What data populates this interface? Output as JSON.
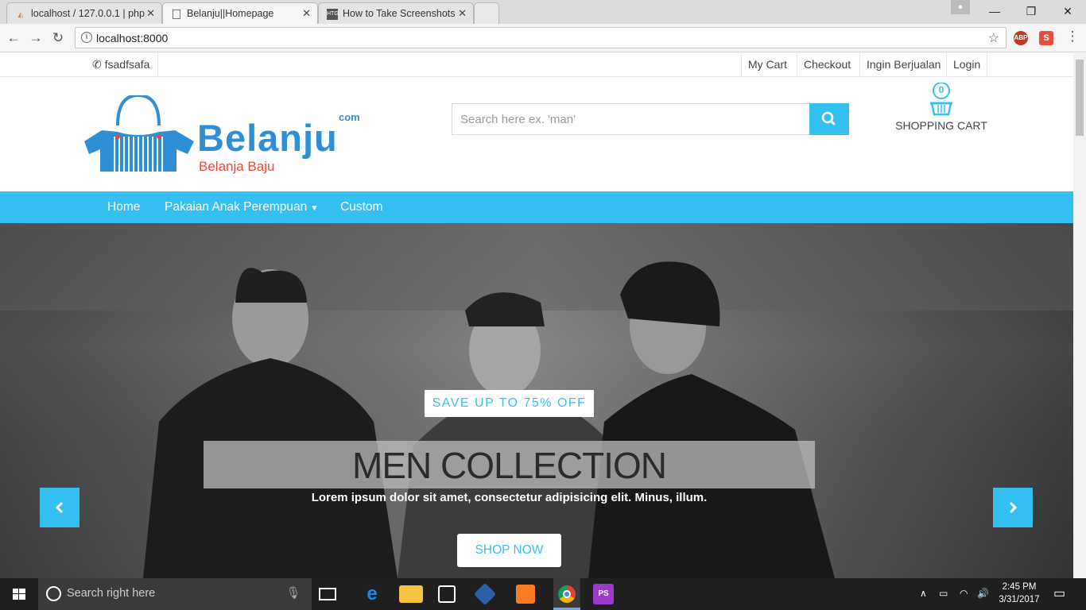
{
  "browser": {
    "tabs": [
      {
        "title": "localhost / 127.0.0.1 | php",
        "favicon": "phpmyadmin-icon"
      },
      {
        "title": "Belanju||Homepage",
        "favicon": "page-icon"
      },
      {
        "title": "How to Take Screenshots",
        "favicon_text": "HTG"
      }
    ],
    "address": "localhost:8000",
    "extensions": {
      "abp": "ABP",
      "s": "S"
    }
  },
  "topbar": {
    "phone": "fsadfsafa",
    "links": [
      "My Cart",
      "Checkout",
      "Ingin Berjualan",
      "Login"
    ]
  },
  "logo": {
    "name": "Belanju",
    "com": "com",
    "tagline": "Belanja Baju"
  },
  "search": {
    "placeholder": "Search here ex. 'man'"
  },
  "cart": {
    "count": "0",
    "label": "SHOPPING CART"
  },
  "menu": {
    "items": [
      "Home",
      "Pakaian Anak Perempuan",
      "Custom"
    ]
  },
  "hero": {
    "badge": "SAVE UP TO 75% OFF",
    "title": "MEN COLLECTION",
    "subtitle": "Lorem ipsum dolor sit amet, consectetur adipisicing elit. Minus, illum.",
    "button": "SHOP NOW"
  },
  "taskbar": {
    "search_placeholder": "Search right here",
    "time": "2:45 PM",
    "date": "3/31/2017"
  },
  "colors": {
    "accent": "#35bff0",
    "logo_blue": "#2e8fd6",
    "logo_red": "#e8473b"
  }
}
